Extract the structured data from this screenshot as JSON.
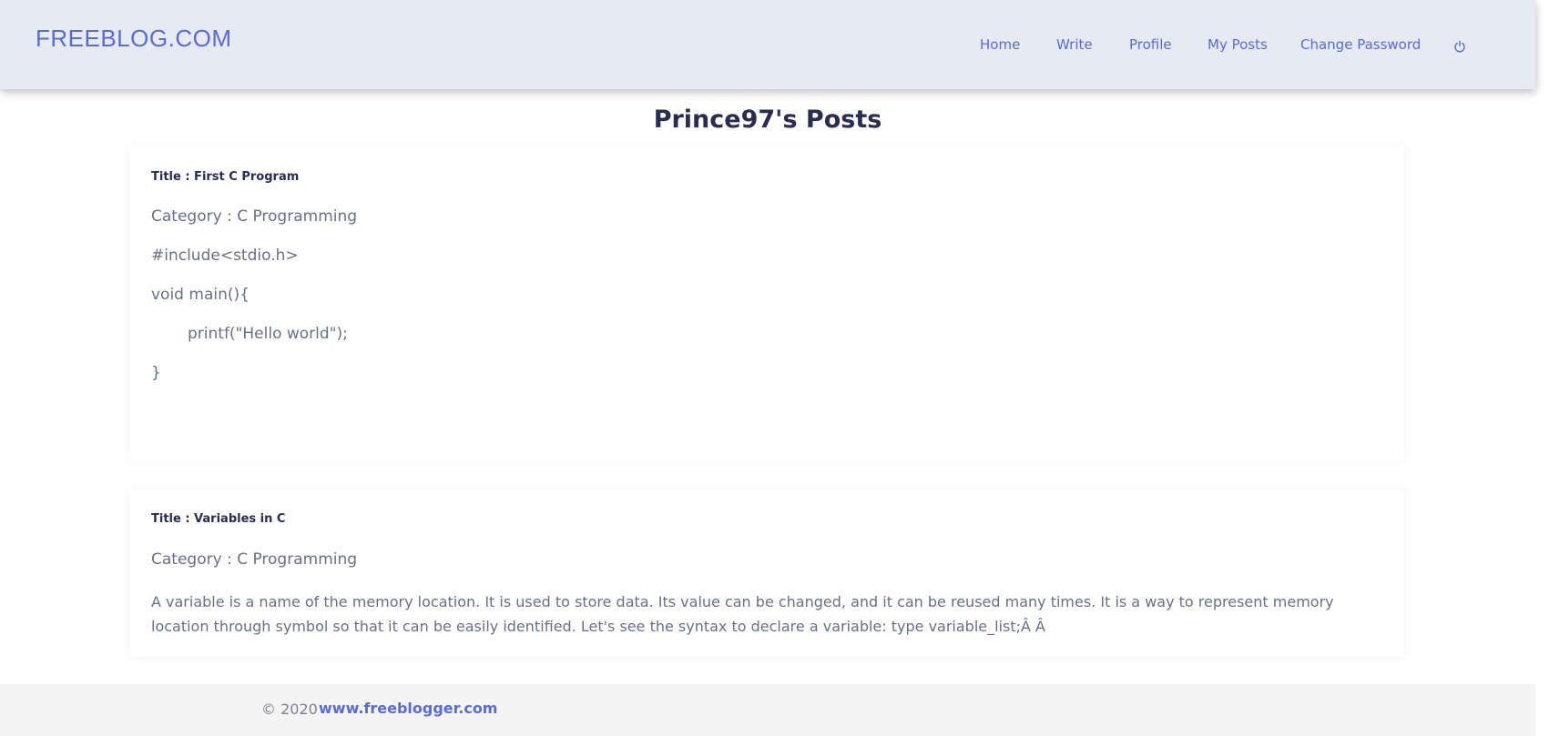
{
  "brand": "FREEBLOG.COM",
  "nav": {
    "home": "Home",
    "write": "Write",
    "profile": "Profile",
    "my_posts": "My Posts",
    "change_password": "Change Password",
    "logout_icon": "power-icon"
  },
  "page_title": "Prince97's Posts",
  "posts": [
    {
      "title": "Title : First C Program",
      "category": "Category : C Programming",
      "lines": [
        "#include<stdio.h>",
        "void main(){",
        "printf(\"Hello world\");",
        "}"
      ]
    },
    {
      "title": "Title : Variables in C",
      "category": "Category : C Programming",
      "body": "A variable is a name of the memory location. It is used to store data. Its value can be changed, and it can be reused many times. It is a way to represent memory location through symbol so that it can be easily identified. Let's see the syntax to declare a variable: type variable_list;Â Â"
    }
  ],
  "footer": {
    "copyright": "© 2020",
    "link": "www.freeblogger.com"
  },
  "colors": {
    "accent": "#5a6bd9",
    "navbar_bg": "#e6eaf2",
    "heading": "#2a2d50",
    "body_text": "#6b6f85"
  }
}
